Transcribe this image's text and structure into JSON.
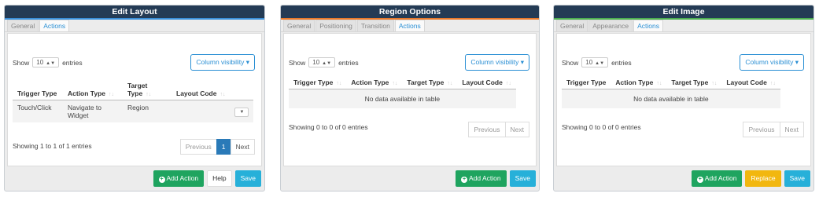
{
  "panels": [
    {
      "title": "Edit Layout",
      "tabs": [
        "General",
        "Actions"
      ],
      "show_label": "Show",
      "show_value": "10",
      "entries_label": "entries",
      "colvis_label": "Column visibility",
      "columns": [
        "Trigger Type",
        "Action Type",
        "Target Type",
        "Layout Code"
      ],
      "rows": [
        [
          "Touch/Click",
          "Navigate to Widget",
          "Region",
          ""
        ]
      ],
      "empty_text": "",
      "info": "Showing 1 to 1 of 1 entries",
      "pager": [
        "Previous",
        "1",
        "Next"
      ],
      "buttons": [
        "Add Action",
        "Help",
        "Save"
      ]
    },
    {
      "title": "Region Options",
      "tabs": [
        "General",
        "Positioning",
        "Transition",
        "Actions"
      ],
      "show_label": "Show",
      "show_value": "10",
      "entries_label": "entries",
      "colvis_label": "Column visibility",
      "columns": [
        "Trigger Type",
        "Action Type",
        "Target Type",
        "Layout Code"
      ],
      "rows": [],
      "empty_text": "No data available in table",
      "info": "Showing 0 to 0 of 0 entries",
      "pager": [
        "Previous",
        "Next"
      ],
      "buttons": [
        "Add Action",
        "Save"
      ]
    },
    {
      "title": "Edit Image",
      "tabs": [
        "General",
        "Appearance",
        "Actions"
      ],
      "show_label": "Show",
      "show_value": "10",
      "entries_label": "entries",
      "colvis_label": "Column visibility",
      "columns": [
        "Trigger Type",
        "Action Type",
        "Target Type",
        "Layout Code"
      ],
      "rows": [],
      "empty_text": "No data available in table",
      "info": "Showing 0 to 0 of 0 entries",
      "pager": [
        "Previous",
        "Next"
      ],
      "buttons": [
        "Add Action",
        "Replace",
        "Save"
      ]
    }
  ],
  "colors": {
    "header_bg": "#243b55",
    "accent_blue": "#2a8fd4",
    "success": "#1fa45f",
    "info": "#27b0d9",
    "warning": "#f2b70f"
  }
}
